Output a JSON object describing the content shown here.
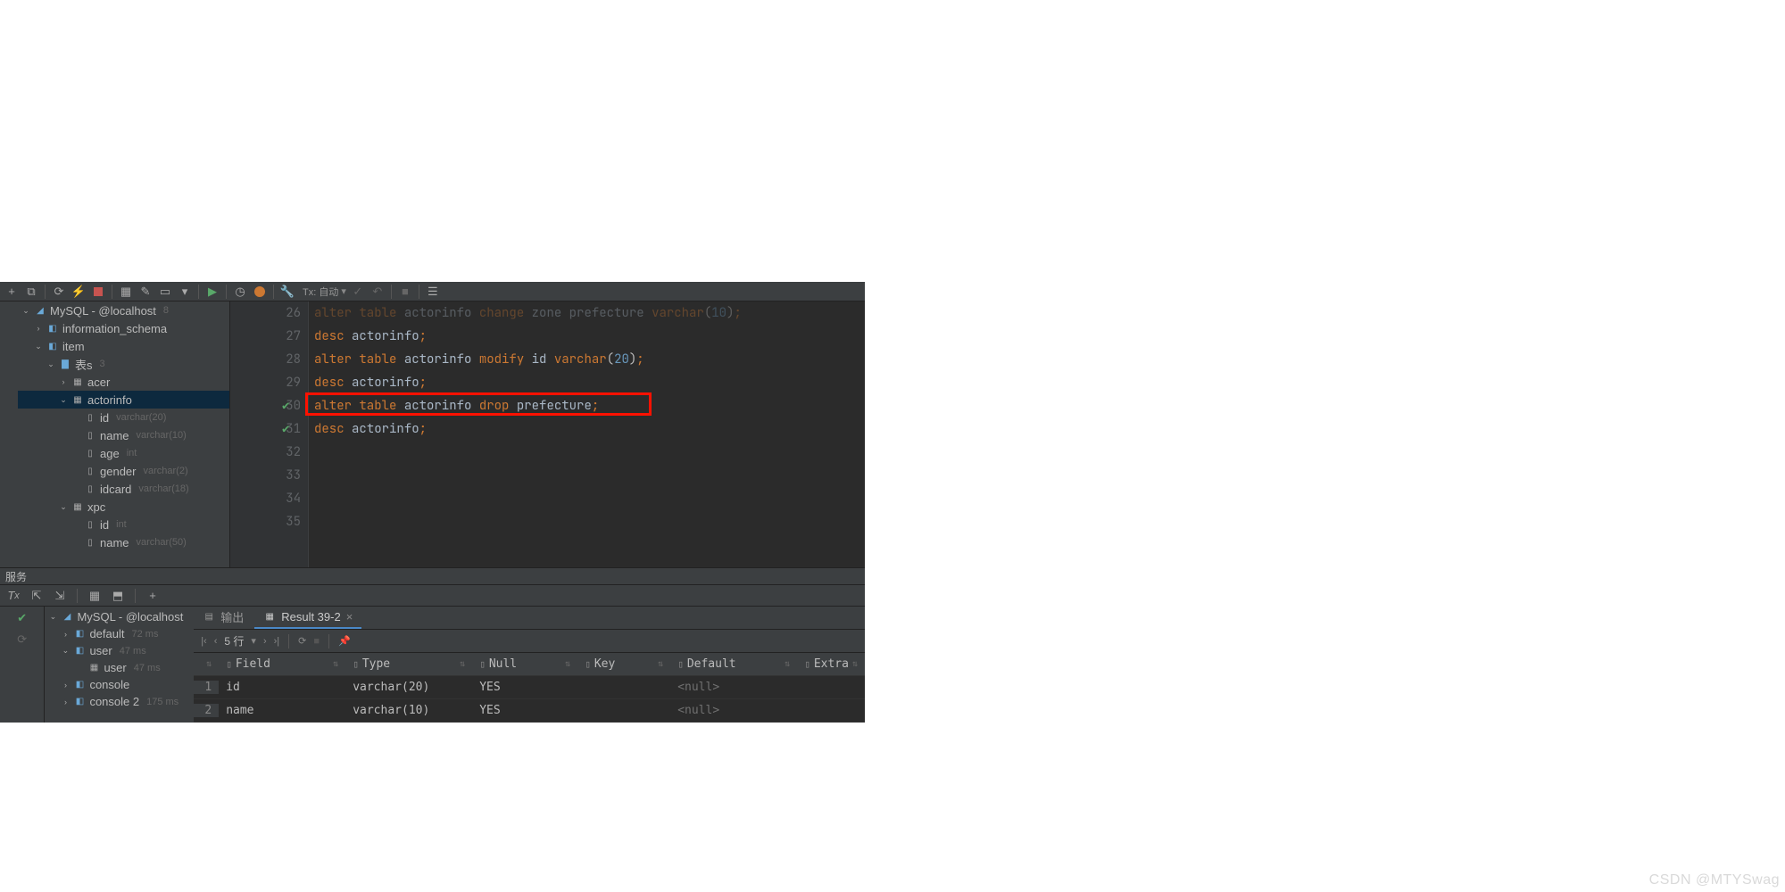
{
  "toolbar": {
    "tx_label": "Tx: 自动"
  },
  "db_tree": {
    "root": {
      "label": "MySQL - @localhost",
      "badge": "8"
    },
    "information_schema": "information_schema",
    "item": "item",
    "tables_folder": {
      "label": "表s",
      "count": "3"
    },
    "acer": "acer",
    "actorinfo": "actorinfo",
    "cols_actorinfo": [
      {
        "name": "id",
        "type": "varchar(20)"
      },
      {
        "name": "name",
        "type": "varchar(10)"
      },
      {
        "name": "age",
        "type": "int"
      },
      {
        "name": "gender",
        "type": "varchar(2)"
      },
      {
        "name": "idcard",
        "type": "varchar(18)"
      }
    ],
    "xpc": "xpc",
    "cols_xpc": [
      {
        "name": "id",
        "type": "int"
      },
      {
        "name": "name",
        "type": "varchar(50)"
      }
    ]
  },
  "editor": {
    "lines": [
      {
        "n": "26",
        "html": "<span class='kw'>alter</span> <span class='kw'>table</span> <span class='ident'>actorinfo</span> <span class='kw'>change</span> <span class='ident'>zone</span> <span class='ident'>prefecture</span> <span class='typec'>varchar</span>(<span class='num'>10</span>)<span class='semi'>;</span>"
      },
      {
        "n": "27",
        "html": "<span class='kw'>desc</span> <span class='ident'>actorinfo</span><span class='semi'>;</span>"
      },
      {
        "n": "28",
        "html": "<span class='kw'>alter</span> <span class='kw'>table</span> <span class='ident'>actorinfo</span> <span class='kw'>modify</span> <span class='ident'>id</span> <span class='typec'>varchar</span>(<span class='num'>20</span>)<span class='semi'>;</span>"
      },
      {
        "n": "29",
        "html": "<span class='kw'>desc</span> <span class='ident'>actorinfo</span><span class='semi'>;</span>"
      },
      {
        "n": "30",
        "html": "<span class='kw'>alter</span> <span class='kw'>table</span> <span class='ident'>actorinfo</span> <span class='kw'>drop</span> <span class='ident'>prefecture</span><span class='semi'>;</span>",
        "check": true,
        "boxed": true
      },
      {
        "n": "31",
        "html": "<span class='kw'>desc</span> <span class='ident'>actorinfo</span><span class='semi'>;</span>",
        "check": true
      },
      {
        "n": "32",
        "html": ""
      },
      {
        "n": "33",
        "html": ""
      },
      {
        "n": "34",
        "html": ""
      },
      {
        "n": "35",
        "html": ""
      }
    ]
  },
  "services": {
    "title": "服务",
    "tabs": {
      "output": "输出",
      "result": "Result 39-2"
    },
    "pager": {
      "rows": "5 行"
    },
    "tree": {
      "root": "MySQL - @localhost",
      "items": [
        {
          "name": "default",
          "time": "72 ms"
        },
        {
          "name": "user",
          "time": "47 ms",
          "children": [
            {
              "name": "user",
              "time": "47 ms"
            }
          ]
        },
        {
          "name": "console",
          "time": ""
        },
        {
          "name": "console 2",
          "time": "175 ms"
        }
      ]
    },
    "grid": {
      "headers": [
        "Field",
        "Type",
        "Null",
        "Key",
        "Default",
        "Extra"
      ],
      "rows": [
        {
          "idx": "1",
          "cells": [
            "id",
            "varchar(20)",
            "YES",
            "",
            "<null>",
            ""
          ]
        },
        {
          "idx": "2",
          "cells": [
            "name",
            "varchar(10)",
            "YES",
            "",
            "<null>",
            ""
          ]
        }
      ]
    }
  },
  "watermark": "CSDN @MTYSwag"
}
